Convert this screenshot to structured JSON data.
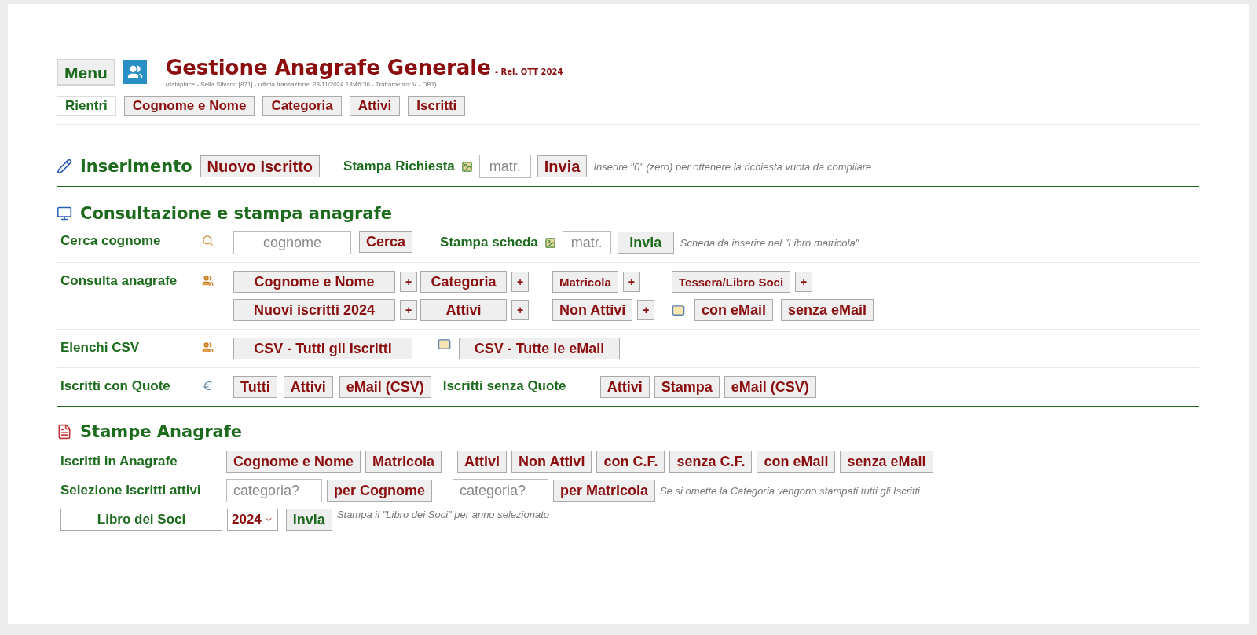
{
  "header": {
    "menu": "Menu",
    "title": "Gestione Anagrafe Generale",
    "release": "- Rel. OTT 2024",
    "info": "(dataplace - Sella Silvano [871] - ultima transazione: 23/11/2024 13:46:36 - Trattamento: V - DB1)",
    "tabs": [
      {
        "label": "Rientri",
        "selected": true
      },
      {
        "label": "Cognome e Nome",
        "selected": false
      },
      {
        "label": "Categoria",
        "selected": false
      },
      {
        "label": "Attivi",
        "selected": false
      },
      {
        "label": "Iscritti",
        "selected": false
      }
    ]
  },
  "inserimento": {
    "title": "Inserimento",
    "new_button": "Nuovo Iscritto",
    "print_label": "Stampa Richiesta",
    "field": {
      "placeholder": "matr."
    },
    "send": "Invia",
    "note": "Inserire \"0\" (zero) per ottenere la richiesta vuota da compilare"
  },
  "consultazione": {
    "title": "Consultazione e stampa anagrafe",
    "search": {
      "label": "Cerca cognome",
      "field": {
        "placeholder": "cognome"
      },
      "button": "Cerca",
      "print_label": "Stampa scheda",
      "print_field": {
        "placeholder": "matr."
      },
      "send": "Invia",
      "note": "Scheda da inserire nel \"Libro matricola\""
    },
    "consulta": {
      "label": "Consulta anagrafe",
      "rows": [
        [
          {
            "label": "Cognome e Nome",
            "plus": "+",
            "compact": false
          },
          {
            "label": "Categoria",
            "plus": "+",
            "compact": false
          },
          {
            "label": "Matricola",
            "plus": "+",
            "compact": true
          },
          {
            "label": "Tessera/Libro Soci",
            "plus": "+",
            "compact": true
          }
        ],
        [
          {
            "label": "Nuovi iscritti 2024",
            "plus": "+",
            "compact": false
          },
          {
            "label": "Attivi",
            "plus": "+",
            "compact": false
          },
          {
            "label": "Non Attivi",
            "plus": "+",
            "compact": false
          }
        ]
      ],
      "email_buttons": [
        "con eMail",
        "senza eMail"
      ]
    },
    "csv": {
      "label": "Elenchi CSV",
      "all_members": "CSV - Tutti gli Iscritti",
      "all_emails": "CSV - Tutte le eMail"
    },
    "quote": {
      "label": "Iscritti con Quote",
      "buttons": [
        "Tutti",
        "Attivi",
        "eMail (CSV)"
      ],
      "label_without": "Iscritti senza Quote",
      "buttons_without": [
        "Attivi",
        "Stampa",
        "eMail (CSV)"
      ]
    }
  },
  "stampe": {
    "title": "Stampe Anagrafe",
    "registry": {
      "label": "Iscritti in Anagrafe",
      "buttons": [
        "Cognome e Nome",
        "Matricola",
        "Attivi",
        "Non Attivi",
        "con C.F.",
        "senza C.F.",
        "con eMail",
        "senza eMail"
      ]
    },
    "selection": {
      "label": "Selezione Iscritti attivi",
      "field1": {
        "placeholder": "categoria?"
      },
      "button1": "per Cognome",
      "field2": {
        "placeholder": "categoria?"
      },
      "button2": "per Matricola",
      "note": "Se si omette la Categoria vengono stampati tutti gli Iscritti"
    },
    "book": {
      "label": "Libro dei Soci",
      "year": "2024",
      "send": "Invia",
      "note": "Stampa il \"Libro dei Soci\" per anno selezionato"
    }
  }
}
